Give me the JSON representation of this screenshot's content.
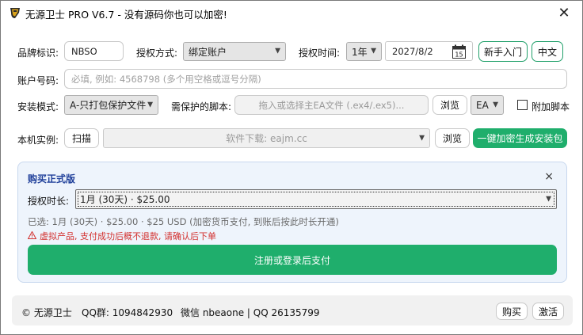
{
  "window": {
    "title": "无源卫士 PRO V6.7 - 没有源码你也可以加密!",
    "app_icon": "shield-logo-icon",
    "close_glyph": "✕"
  },
  "brand": {
    "label": "品牌标识:",
    "value": "NBSO"
  },
  "auth_method": {
    "label": "授权方式:",
    "value": "绑定账户"
  },
  "auth_time": {
    "label": "授权时间:",
    "duration": "1年",
    "date": "2027/8/2",
    "calendar_day": "15"
  },
  "buttons": {
    "beginner": "新手入门",
    "language": "中文",
    "browse": "浏览",
    "scan": "扫描",
    "browse2": "浏览",
    "generate": "一键加密生成安装包"
  },
  "account": {
    "label": "账户号码:",
    "placeholder": "必填, 例如: 4568798 (多个用空格或逗号分隔)"
  },
  "install_mode": {
    "label": "安装模式:",
    "value": "A-只打包保护文件"
  },
  "script": {
    "label": "需保护的脚本:",
    "placeholder": "拖入或选择主EA文件 (.ex4/.ex5)...",
    "type": "EA",
    "extra_label": "附加脚本"
  },
  "instance": {
    "label": "本机实例:",
    "value": "软件下载: eajm.cc"
  },
  "purchase": {
    "title": "购买正式版",
    "close_glyph": "×",
    "duration_label": "授权时长:",
    "duration_value": "1月 (30天) · $25.00",
    "selected_info": "已选: 1月 (30天) · $25.00 · $25 USD (加密货币支付, 到账后按此时长开通)",
    "warning": "虚拟产品, 支付成功后概不退款, 请确认后下单",
    "pay_button": "注册或登录后支付"
  },
  "footer": {
    "copyright": "© 无源卫士",
    "qq_group": "QQ群: 1094842930",
    "wechat": "微信 nbeaone | QQ 26135799",
    "buy": "购买",
    "activate": "激活"
  },
  "colors": {
    "accent_green": "#1fae6c",
    "panel_bg": "#eef4fc",
    "panel_title": "#1f3f9a",
    "warning_red": "#d3312f"
  }
}
